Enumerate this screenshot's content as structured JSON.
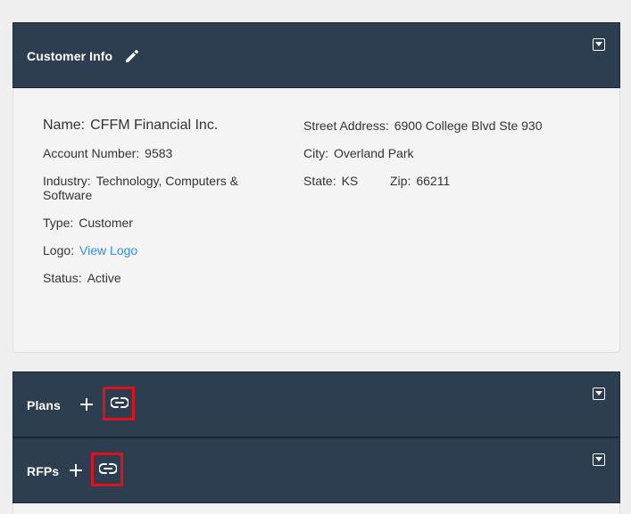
{
  "customer_info": {
    "title": "Customer Info",
    "name_label": "Name:",
    "name_value": "CFFM Financial Inc.",
    "account_label": "Account Number:",
    "account_value": "9583",
    "industry_label": "Industry:",
    "industry_value_line1": "Technology, Computers &",
    "industry_value_line2": "Software",
    "type_label": "Type:",
    "type_value": "Customer",
    "logo_label": "Logo:",
    "logo_link": "View Logo",
    "status_label": "Status:",
    "status_value": "Active",
    "street_label": "Street Address:",
    "street_value": "6900 College Blvd Ste 930",
    "city_label": "City:",
    "city_value": "Overland Park",
    "state_label": "State:",
    "state_value": "KS",
    "zip_label": "Zip:",
    "zip_value": "66211"
  },
  "plans": {
    "title": "Plans"
  },
  "rfps": {
    "title": "RFPs"
  },
  "icons": {
    "edit": "pencil-icon",
    "add": "plus-icon",
    "link": "link-icon",
    "collapse": "collapse-icon"
  },
  "colors": {
    "header_bg": "#2c3e50",
    "highlight": "#e0111b",
    "link": "#2f8fe6"
  }
}
